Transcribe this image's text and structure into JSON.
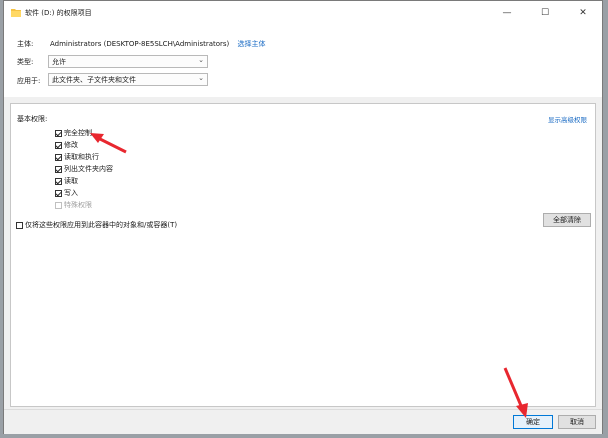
{
  "window": {
    "title": "软件 (D:) 的权限项目",
    "minimize_glyph": "—",
    "maximize_glyph": "☐",
    "close_glyph": "✕"
  },
  "principal": {
    "label": "主体:",
    "value": "Administrators (DESKTOP-8E5SLCH\\Administrators)",
    "select_link": "选择主体"
  },
  "type": {
    "label": "类型:",
    "value": "允许"
  },
  "applies_to": {
    "label": "应用于:",
    "value": "此文件夹、子文件夹和文件"
  },
  "permissions": {
    "heading": "基本权限:",
    "advanced_link": "显示高级权限",
    "items": [
      {
        "label": "完全控制",
        "checked": true,
        "disabled": false
      },
      {
        "label": "修改",
        "checked": true,
        "disabled": false
      },
      {
        "label": "读取和执行",
        "checked": true,
        "disabled": false
      },
      {
        "label": "列出文件夹内容",
        "checked": true,
        "disabled": false
      },
      {
        "label": "读取",
        "checked": true,
        "disabled": false
      },
      {
        "label": "写入",
        "checked": true,
        "disabled": false
      },
      {
        "label": "特殊权限",
        "checked": false,
        "disabled": true
      }
    ],
    "apply_only_label": "仅将这些权限应用到此容器中的对象和/或容器(T)",
    "clear_all": "全部清除"
  },
  "buttons": {
    "ok": "确定",
    "cancel": "取消"
  },
  "colors": {
    "link": "#1a6bc4",
    "annotation_arrow": "#e8272f",
    "ok_border": "#0078d7"
  },
  "icons": [
    "folder-icon",
    "dropdown-chevron-icon",
    "checkbox-icon",
    "red-annotation-arrow-icon"
  ]
}
